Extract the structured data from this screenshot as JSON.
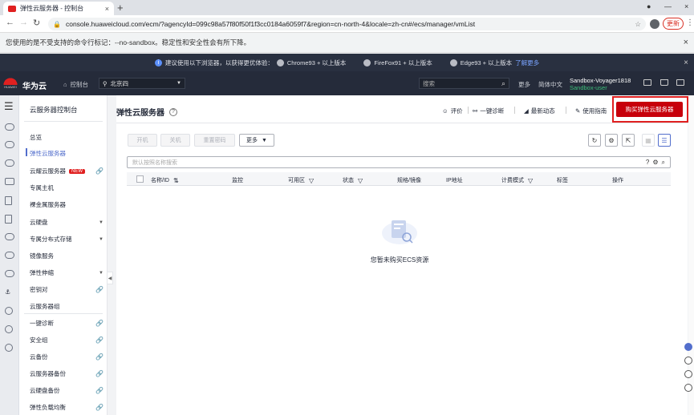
{
  "browser": {
    "tab_title": "弹性云服务器 - 控制台",
    "tab_close": "×",
    "new_tab": "+",
    "url": "console.huaweicloud.com/ecm/?agencyId=099c98a57f80f50f1f3cc0184a6059f7&region=cn-north-4&locale=zh-cn#/ecs/manager/vmList",
    "update_label": "更新",
    "infobar_text": "您使用的是不受支持的命令行标记：--no-sandbox。稳定性和安全性会有所下降。",
    "close_glyph": "×"
  },
  "notice": {
    "text": "建议使用以下浏览器，以获得更优体验：",
    "chrome": "Chrome93 + 以上版本",
    "firefox": "FireFox91 + 以上版本",
    "edge": "Edge93 + 以上版本",
    "link": "了解更多"
  },
  "topnav": {
    "logo_text": "HUAWEI",
    "brand": "华为云",
    "console": "控制台",
    "region": "北京四",
    "search_placeholder": "搜索",
    "more": "更多",
    "language": "简体中文",
    "user": "Sandbox-Voyager1818",
    "user_sub": "Sandbox-user"
  },
  "sidebar": {
    "title": "云服务器控制台",
    "items": [
      {
        "label": "总览"
      },
      {
        "label": "弹性云服务器",
        "active": true
      },
      {
        "label": "云耀云服务器",
        "badge": "NEW",
        "link": true
      },
      {
        "label": "专属主机"
      },
      {
        "label": "裸金属服务器"
      },
      {
        "label": "云硬盘",
        "caret": true
      },
      {
        "label": "专属分布式存储",
        "caret": true
      },
      {
        "label": "镜像服务"
      },
      {
        "label": "弹性伸缩",
        "caret": true
      },
      {
        "label": "密钥对",
        "link": true
      },
      {
        "label": "云服务器组"
      },
      {
        "label": "一键诊断",
        "link": true
      },
      {
        "label": "安全组",
        "link": true
      },
      {
        "label": "云备份",
        "link": true
      },
      {
        "label": "云服务器备份",
        "link": true
      },
      {
        "label": "云硬盘备份",
        "link": true
      },
      {
        "label": "弹性负载均衡",
        "link": true
      }
    ]
  },
  "main": {
    "title": "弹性云服务器",
    "actions": {
      "rate": "评价",
      "diagnose": "一键诊断",
      "news": "最新动态",
      "guide": "使用指南"
    },
    "buy_button": "购买弹性云服务器",
    "toolbar": {
      "start": "开机",
      "stop": "关机",
      "reset_pwd": "重置密码",
      "more": "更多"
    },
    "filter_placeholder": "默认按照名称搜索",
    "columns": [
      "名称/ID",
      "监控",
      "可用区",
      "状态",
      "规格/镜像",
      "IP地址",
      "计费模式",
      "标签",
      "操作"
    ],
    "empty_text": "您暂未购买ECS资源"
  }
}
